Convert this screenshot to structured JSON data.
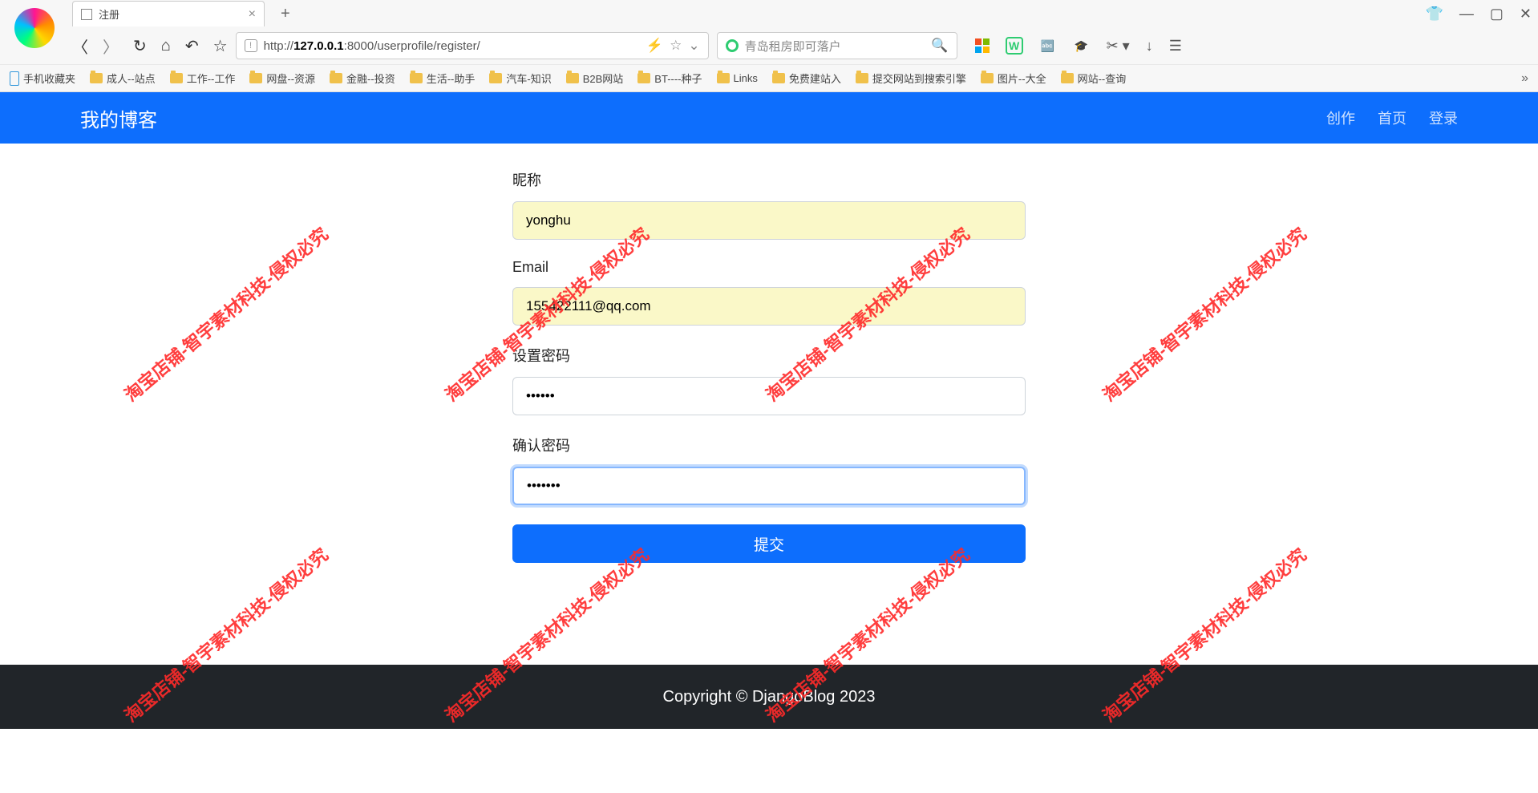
{
  "browser": {
    "tab_title": "注册",
    "url_prefix": "http://",
    "url_host": "127.0.0.1",
    "url_rest": ":8000/userprofile/register/",
    "search_placeholder": "青岛租房即可落户"
  },
  "win_controls": {
    "shirt": "👕",
    "minimize": "—",
    "maximize": "▢",
    "close": "✕"
  },
  "bookmarks": [
    "手机收藏夹",
    "成人--站点",
    "工作--工作",
    "网盘--资源",
    "金融--投资",
    "生活--助手",
    "汽车-知识",
    "B2B网站",
    "BT----种子",
    "Links",
    "免费建站入",
    "提交网站到搜索引擎",
    "图片--大全",
    "网站--查询"
  ],
  "nav": {
    "brand": "我的博客",
    "create": "创作",
    "home": "首页",
    "login": "登录"
  },
  "form": {
    "nickname_label": "昵称",
    "nickname_value": "yonghu",
    "email_label": "Email",
    "email_value": "155422111@qq.com",
    "password_label": "设置密码",
    "password_value": "••••••",
    "confirm_label": "确认密码",
    "confirm_value": "•••••••",
    "submit_label": "提交"
  },
  "footer": {
    "text": "Copyright © DjangoBlog 2023"
  },
  "watermark": "淘宝店铺-智宇素材科技-侵权必究"
}
